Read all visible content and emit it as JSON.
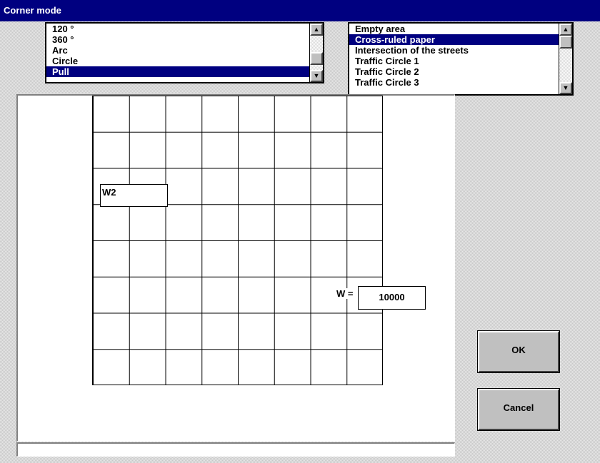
{
  "window": {
    "title": "Corner mode"
  },
  "mode_list": {
    "items": [
      "120 °",
      "360 °",
      "Arc",
      "Circle",
      "Pull"
    ],
    "selected_index": 4
  },
  "template_list": {
    "items": [
      "Empty area",
      "Cross-ruled paper",
      "Intersection of the streets",
      "Traffic Circle 1",
      "Traffic Circle 2",
      "Traffic Circle 3"
    ],
    "selected_index": 1
  },
  "canvas": {
    "w2_label": "W2",
    "w_label": "W =",
    "w_value": "10000"
  },
  "status": {
    "text": ""
  },
  "buttons": {
    "ok": "OK",
    "cancel": "Cancel"
  },
  "colors": {
    "titlebar": "#000080",
    "selection": "#000080"
  }
}
